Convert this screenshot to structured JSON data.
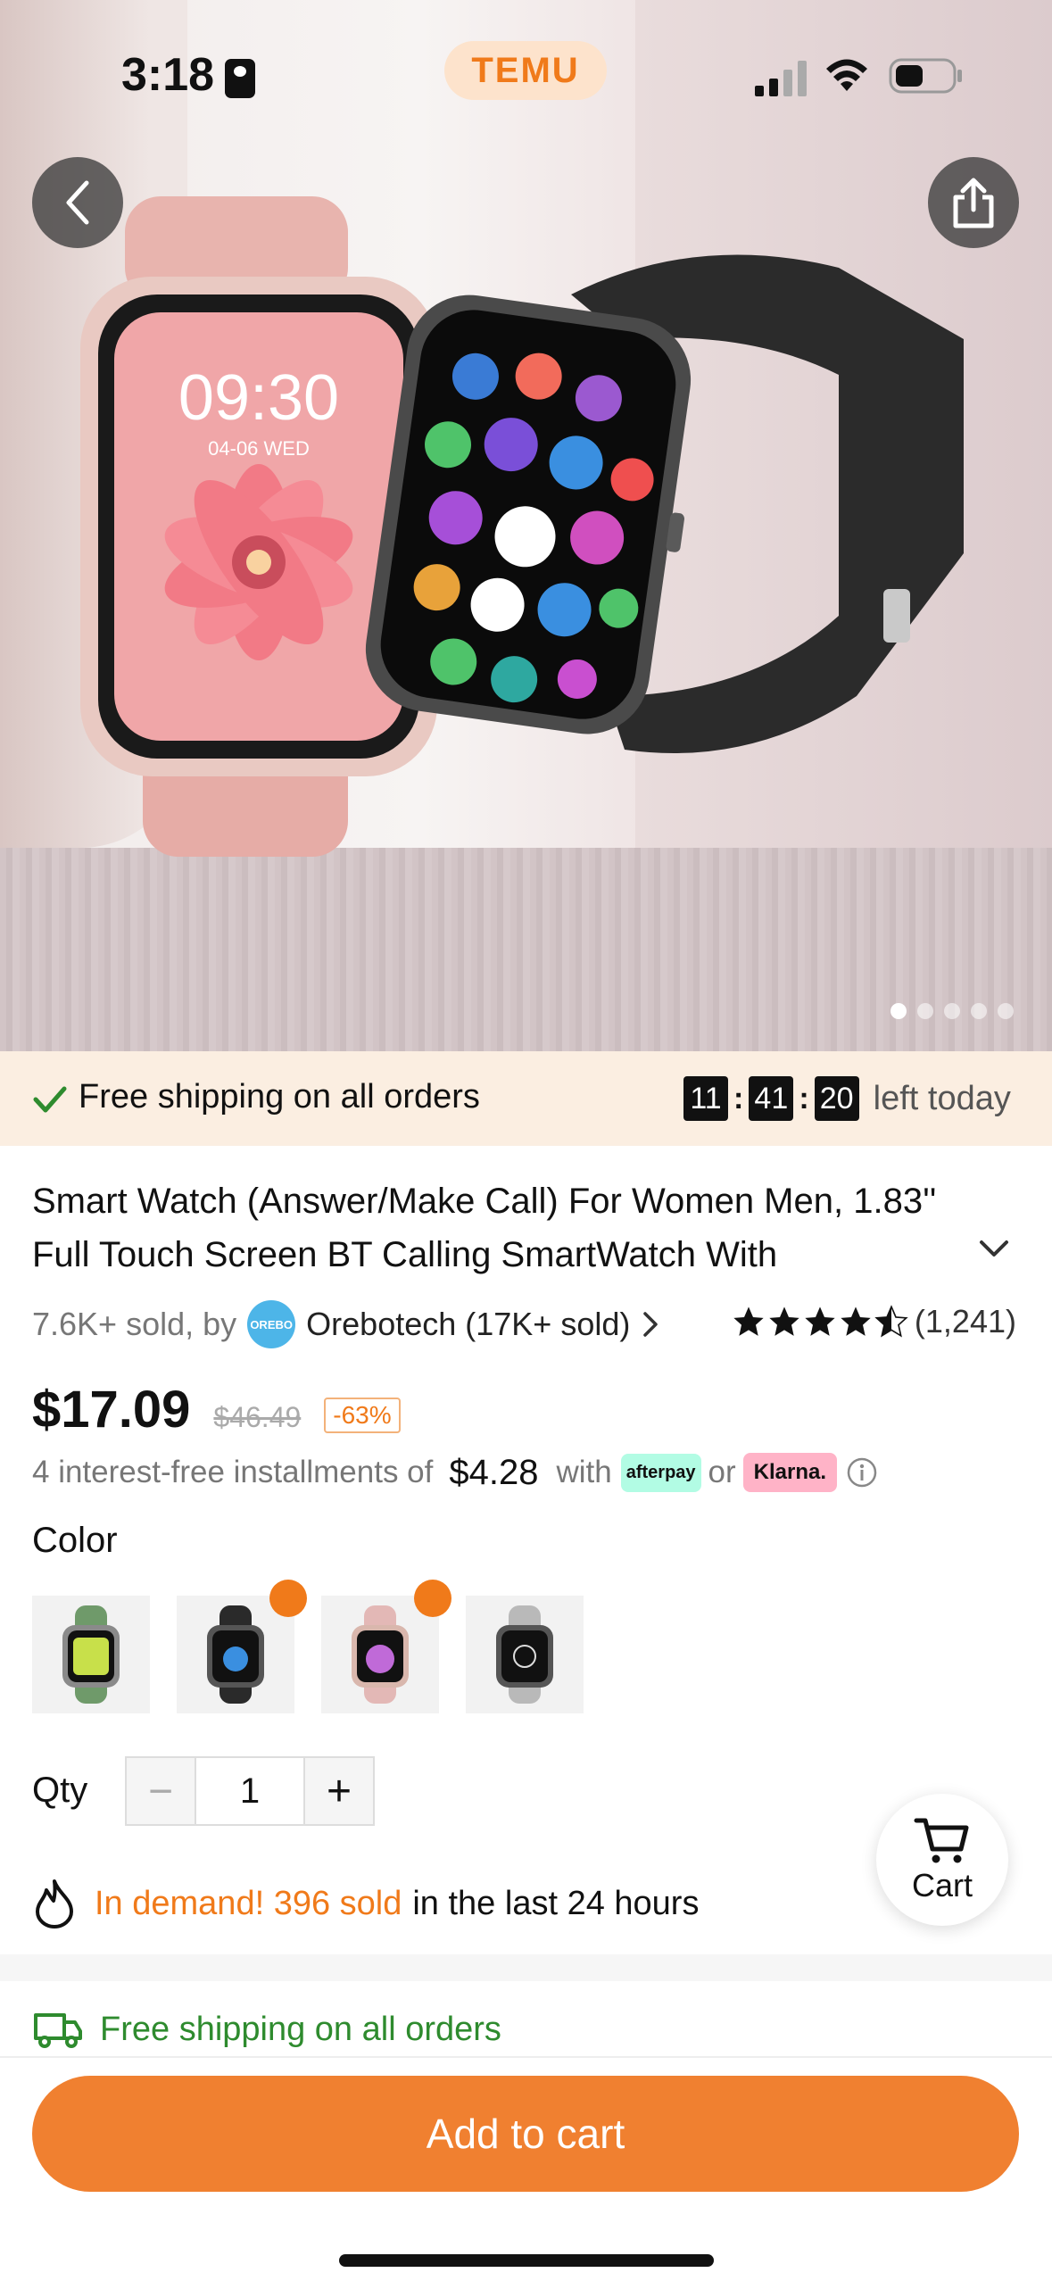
{
  "status_bar": {
    "time": "3:18",
    "app_badge": "TEMU"
  },
  "gallery": {
    "image_count": 5,
    "active_index": 0,
    "watch_time": "09:30",
    "watch_date": "04-06 WED"
  },
  "banner": {
    "shipping_text": "Free shipping on all orders",
    "timer": {
      "hours": "11",
      "minutes": "41",
      "seconds": "20"
    },
    "timer_suffix": "left today"
  },
  "product": {
    "title": "Smart Watch (Answer/Make Call) For Women Men, 1.83'' Full Touch Screen BT Calling SmartWatch With",
    "sold_prefix": "7.6K+ sold, by",
    "store_logo_text": "OREBO",
    "store_name": "Orebotech (17K+ sold)",
    "rating_count": "(1,241)",
    "rating_value": 4.5,
    "price": "$17.09",
    "original_price": "$46.49",
    "discount": "-63%"
  },
  "installments": {
    "prefix": "4 interest-free installments of",
    "amount": "$4.28",
    "with_text": "with",
    "afterpay_label": "afterpay",
    "or_text": "or",
    "klarna_label": "Klarna."
  },
  "color": {
    "label": "Color",
    "options": [
      {
        "name": "green",
        "hot": false,
        "color": "#6f9a6a"
      },
      {
        "name": "black",
        "hot": true,
        "color": "#2a2a2a"
      },
      {
        "name": "pink",
        "hot": true,
        "color": "#e3b8b6"
      },
      {
        "name": "grey",
        "hot": false,
        "color": "#b9b9b9"
      }
    ]
  },
  "qty": {
    "label": "Qty",
    "minus": "−",
    "value": "1",
    "plus": "+"
  },
  "cart_fab": {
    "label": "Cart"
  },
  "demand": {
    "highlight": "In demand! 396 sold",
    "rest": "in the last 24 hours"
  },
  "shipping2": {
    "text": "Free shipping on all orders"
  },
  "add_to_cart": {
    "label": "Add to cart"
  },
  "colors": {
    "accent": "#f08030",
    "temu_orange": "#f07a1a",
    "green": "#2e8b2e",
    "banner_bg": "#fbeee1"
  }
}
